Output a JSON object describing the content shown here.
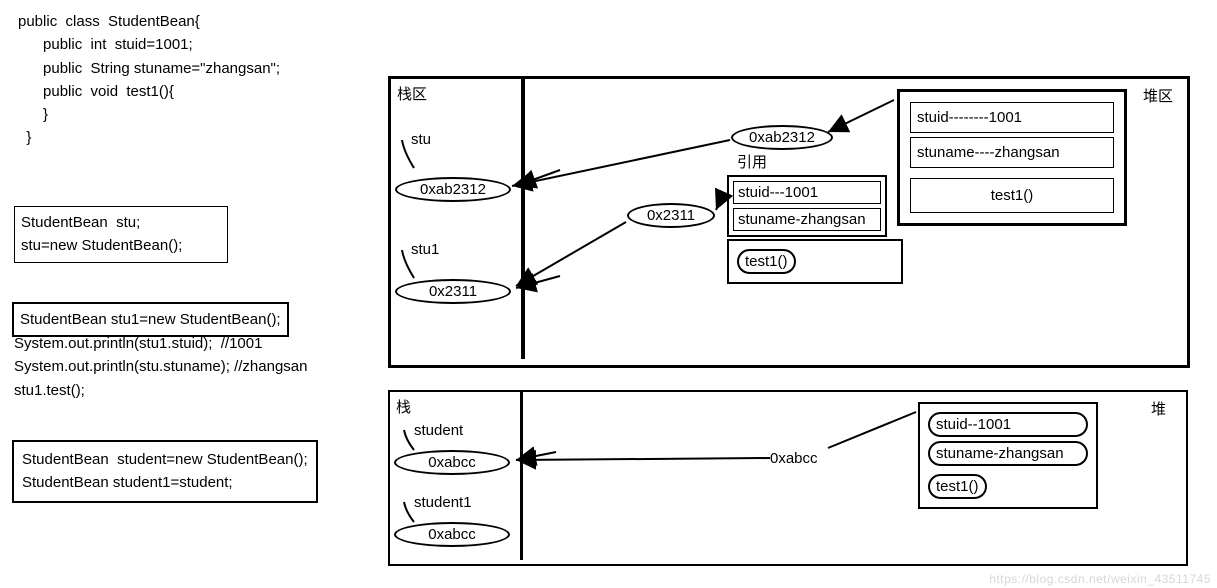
{
  "code": {
    "l1": "public  class  StudentBean{",
    "l2": "      public  int  stuid=1001;",
    "l3": "      public  String stuname=\"zhangsan\";",
    "l4": "      public  void  test1(){",
    "l5": "",
    "l6": "      }",
    "l7": "  }",
    "box1_l1": "StudentBean  stu;",
    "box1_l2": "stu=new StudentBean();",
    "box2_l1": "StudentBean stu1=new StudentBean();",
    "mid_l1": "System.out.println(stu1.stuid);  //1001",
    "mid_l2": "System.out.println(stu.stuname); //zhangsan",
    "mid_l3": "stu1.test();",
    "box3_l1": "StudentBean  student=new StudentBean();",
    "box3_l2": "StudentBean student1=student;"
  },
  "diagram1": {
    "stack_label": "栈区",
    "heap_label": "堆区",
    "stu_name": "stu",
    "stu_addr": "0xab2312",
    "stu1_name": "stu1",
    "stu1_addr": "0x2311",
    "ref_addr": "0xab2312",
    "ref_label": "引用",
    "mid_addr": "0x2311",
    "obj1": {
      "f1": "stuid---1001",
      "f2": "stuname-zhangsan",
      "f3": "test1()"
    },
    "obj2": {
      "f1": "stuid--------1001",
      "f2": "stuname----zhangsan",
      "f3": "test1()"
    }
  },
  "diagram2": {
    "stack_label": "栈",
    "heap_label": "堆",
    "student_name": "student",
    "student_addr": "0xabcc",
    "student1_name": "student1",
    "student1_addr": "0xabcc",
    "mid_addr": "0xabcc",
    "obj": {
      "f1": "stuid--1001",
      "f2": "stuname-zhangsan",
      "f3": "test1()"
    }
  },
  "watermark": "https://blog.csdn.net/weixin_43511745"
}
